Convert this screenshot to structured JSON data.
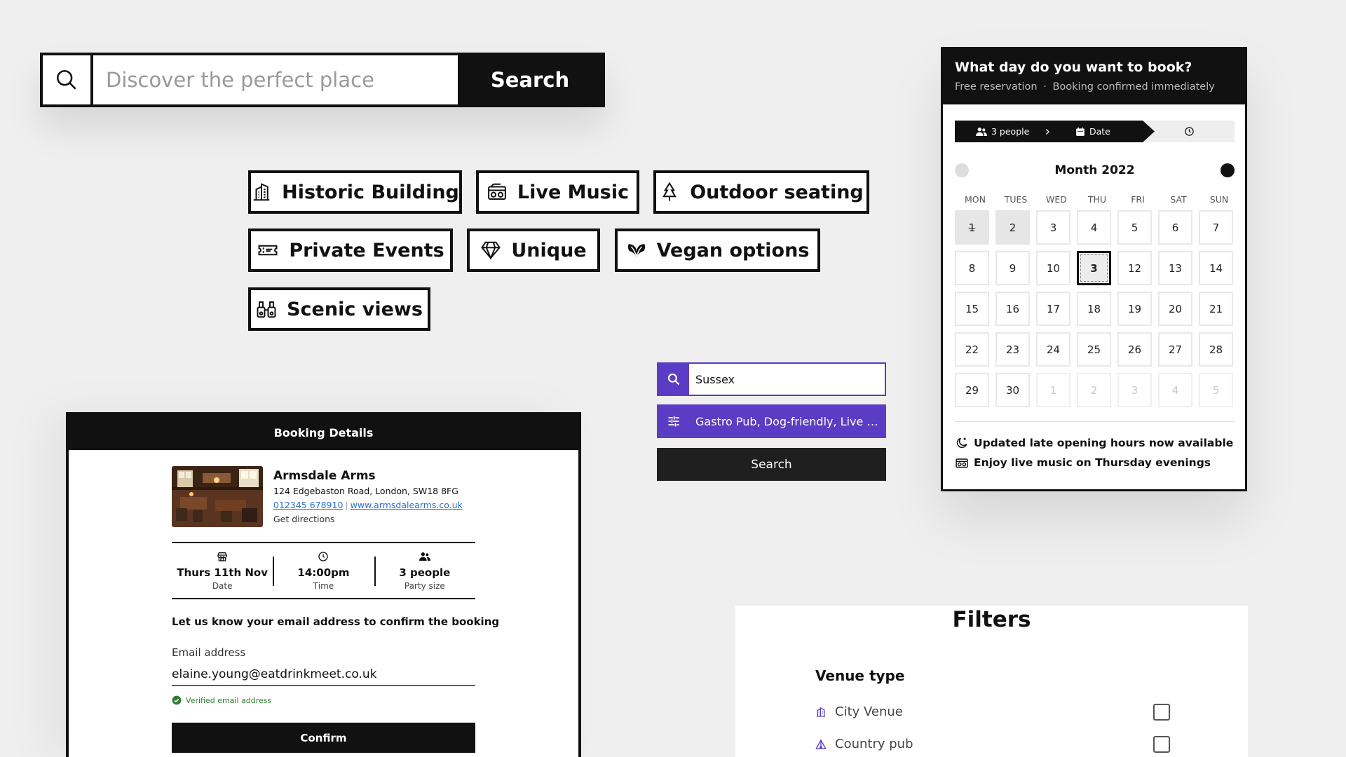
{
  "top_search": {
    "placeholder": "Discover the perfect place",
    "button": "Search",
    "icon": "search-icon"
  },
  "tags": [
    {
      "label": "Historic Building",
      "icon": "building-icon"
    },
    {
      "label": "Live Music",
      "icon": "radio-icon"
    },
    {
      "label": "Outdoor seating",
      "icon": "tree-icon"
    },
    {
      "label": "Private Events",
      "icon": "ticket-icon"
    },
    {
      "label": "Unique",
      "icon": "diamond-icon"
    },
    {
      "label": "Vegan options",
      "icon": "leaf-icon"
    },
    {
      "label": "Scenic views",
      "icon": "binoculars-icon"
    }
  ],
  "calendar": {
    "title": "What day do you want to book?",
    "subtitle_a": "Free reservation",
    "subtitle_b": "Booking confirmed immediately",
    "step_people": "3 people",
    "step_date": "Date",
    "month": "Month 2022",
    "weekdays": [
      "MON",
      "TUES",
      "WED",
      "THU",
      "FRI",
      "SAT",
      "SUN"
    ],
    "days": [
      "1",
      "2",
      "3",
      "4",
      "5",
      "6",
      "7",
      "8",
      "9",
      "10",
      "3",
      "12",
      "13",
      "14",
      "15",
      "16",
      "17",
      "18",
      "19",
      "20",
      "21",
      "22",
      "23",
      "24",
      "25",
      "26",
      "27",
      "28",
      "29",
      "30",
      "1",
      "2",
      "3",
      "4",
      "5"
    ],
    "note_1": "Updated late opening hours now available",
    "note_2": "Enjoy live music on Thursday evenings"
  },
  "side_search": {
    "location": "Sussex",
    "filters": "Gastro Pub, Dog-friendly, Live M...",
    "button": "Search",
    "accent": "#5b3cc4"
  },
  "booking": {
    "header": "Booking Details",
    "venue_name": "Armsdale Arms",
    "address": "124 Edgebaston Road, London, SW18 8FG",
    "phone": "012345 678910",
    "website": "www.armsdalearms.co.uk",
    "directions": "Get directions",
    "date_value": "Thurs 11th Nov",
    "date_label": "Date",
    "time_value": "14:00pm",
    "time_label": "Time",
    "party_value": "3 people",
    "party_label": "Party size",
    "blurb": "Let us know your email address to confirm the booking",
    "email_label": "Email address",
    "email_value": "elaine.young@eatdrinkmeet.co.uk",
    "verified": "Verified email address",
    "confirm": "Confirm"
  },
  "filters": {
    "title": "Filters",
    "venue_type": "Venue type",
    "options": [
      {
        "label": "City Venue",
        "icon": "city-icon"
      },
      {
        "label": "Country pub",
        "icon": "tent-icon"
      }
    ]
  }
}
